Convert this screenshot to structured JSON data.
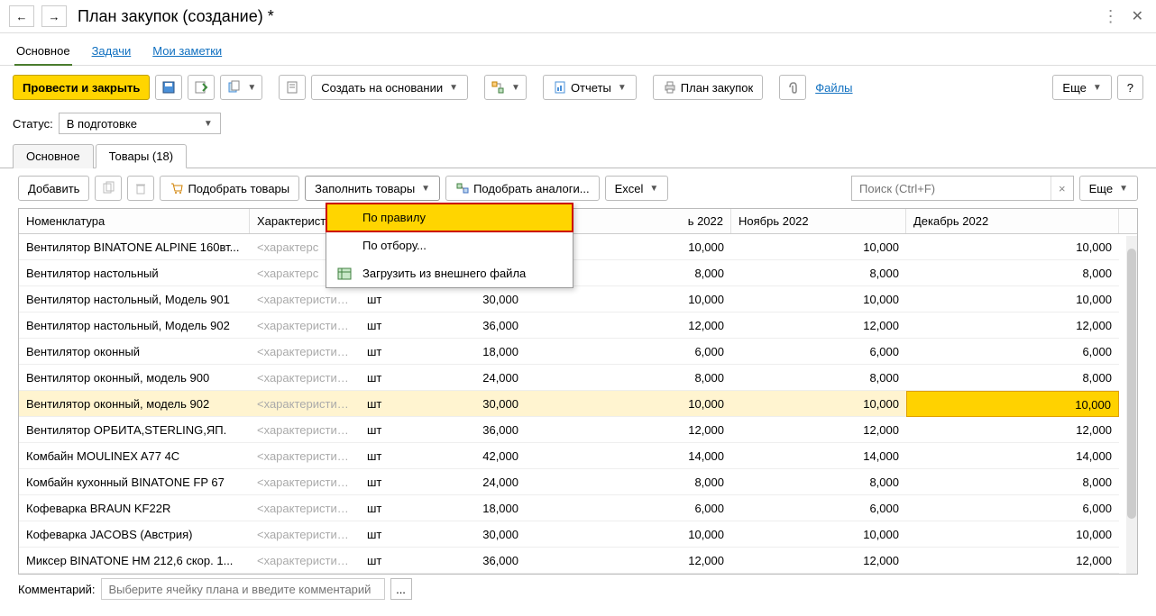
{
  "title": "План закупок (создание) *",
  "main_tabs": {
    "t0": "Основное",
    "t1": "Задачи",
    "t2": "Мои заметки"
  },
  "toolbar": {
    "post_close": "Провести и закрыть",
    "create_based": "Создать на основании",
    "reports": "Отчеты",
    "plan": "План закупок",
    "files": "Файлы",
    "more": "Еще",
    "help": "?"
  },
  "status": {
    "label": "Статус:",
    "value": "В подготовке"
  },
  "inner_tabs": {
    "t0": "Основное",
    "t1": "Товары (18)"
  },
  "tbl_toolbar": {
    "add": "Добавить",
    "pick": "Подобрать товары",
    "fill": "Заполнить товары",
    "analogs": "Подобрать аналоги...",
    "excel": "Excel",
    "search_ph": "Поиск (Ctrl+F)",
    "more": "Еще"
  },
  "dropdown": {
    "by_rule": "По правилу",
    "by_filter": "По отбору...",
    "from_file": "Загрузить из внешнего файла"
  },
  "columns": {
    "c0": "Номенклатура",
    "c1": "Характерист",
    "c2": "",
    "c3": "ь 2022",
    "c4": "Ноябрь 2022",
    "c5": "Декабрь 2022"
  },
  "char_placeholder": "<характеристики...",
  "char_placeholder_short": "<характерс",
  "unit": "шт",
  "rows": [
    {
      "n": "Вентилятор BINATONE ALPINE 160вт...",
      "v2": "",
      "v3": "10,000",
      "v4": "10,000",
      "v5": "10,000",
      "short": true
    },
    {
      "n": "Вентилятор настольный",
      "v2": "",
      "v3": "8,000",
      "v4": "8,000",
      "v5": "8,000",
      "short": true
    },
    {
      "n": "Вентилятор настольный, Модель 901",
      "v2": "30,000",
      "v3": "10,000",
      "v4": "10,000",
      "v5": "10,000"
    },
    {
      "n": "Вентилятор настольный, Модель 902",
      "v2": "36,000",
      "v3": "12,000",
      "v4": "12,000",
      "v5": "12,000"
    },
    {
      "n": "Вентилятор оконный",
      "v2": "18,000",
      "v3": "6,000",
      "v4": "6,000",
      "v5": "6,000"
    },
    {
      "n": "Вентилятор оконный, модель 900",
      "v2": "24,000",
      "v3": "8,000",
      "v4": "8,000",
      "v5": "8,000"
    },
    {
      "n": "Вентилятор оконный, модель 902",
      "v2": "30,000",
      "v3": "10,000",
      "v4": "10,000",
      "v5": "10,000",
      "sel": true
    },
    {
      "n": "Вентилятор ОРБИТА,STERLING,ЯП.",
      "v2": "36,000",
      "v3": "12,000",
      "v4": "12,000",
      "v5": "12,000"
    },
    {
      "n": "Комбайн MOULINEX  A77 4C",
      "v2": "42,000",
      "v3": "14,000",
      "v4": "14,000",
      "v5": "14,000"
    },
    {
      "n": "Комбайн кухонный BINATONE FP 67",
      "v2": "24,000",
      "v3": "8,000",
      "v4": "8,000",
      "v5": "8,000"
    },
    {
      "n": "Кофеварка BRAUN KF22R",
      "v2": "18,000",
      "v3": "6,000",
      "v4": "6,000",
      "v5": "6,000"
    },
    {
      "n": "Кофеварка JACOBS (Австрия)",
      "v2": "30,000",
      "v3": "10,000",
      "v4": "10,000",
      "v5": "10,000"
    },
    {
      "n": "Миксер BINATONE HM 212,6 скор. 1...",
      "v2": "36,000",
      "v3": "12,000",
      "v4": "12,000",
      "v5": "12,000"
    }
  ],
  "comment": {
    "label": "Комментарий:",
    "ph": "Выберите ячейку плана и введите комментарий",
    "btn": "..."
  }
}
